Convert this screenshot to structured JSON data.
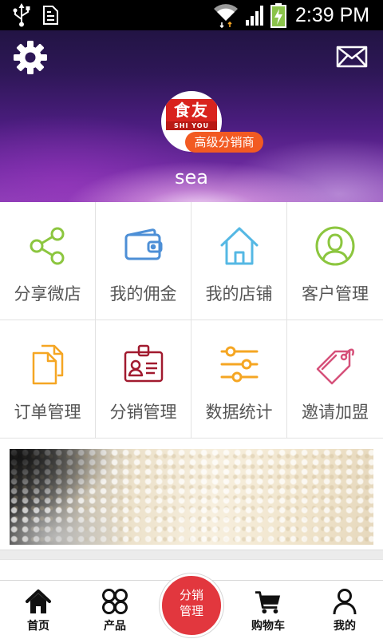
{
  "status_bar": {
    "time": "2:39 PM",
    "left_icons": [
      "usb-icon",
      "notification-app-icon"
    ],
    "right_icons": [
      "wifi-icon",
      "signal-icon",
      "battery-charging-icon"
    ],
    "battery_color": "#8bc34a"
  },
  "header": {
    "left_icon": "gear-icon",
    "right_icon": "envelope-icon"
  },
  "profile": {
    "username": "sea",
    "level_badge": "高级分销商",
    "badge_color": "#f25a22",
    "logo": {
      "main": "食友",
      "sub": "SHI YOU"
    }
  },
  "menu": [
    {
      "label": "分享微店",
      "icon": "share-icon",
      "color": "#8cc63f"
    },
    {
      "label": "我的佣金",
      "icon": "wallet-icon",
      "color": "#4d8fd6"
    },
    {
      "label": "我的店铺",
      "icon": "house-icon",
      "color": "#55b8e4"
    },
    {
      "label": "客户管理",
      "icon": "user-circle-icon",
      "color": "#8cc63f"
    },
    {
      "label": "订单管理",
      "icon": "documents-icon",
      "color": "#f5a623"
    },
    {
      "label": "分销管理",
      "icon": "id-badge-icon",
      "color": "#a11a2f"
    },
    {
      "label": "数据统计",
      "icon": "sliders-icon",
      "color": "#f5a623"
    },
    {
      "label": "邀请加盟",
      "icon": "tag-icon",
      "color": "#d6517a"
    }
  ],
  "bottom_nav": {
    "items": [
      {
        "label": "首页",
        "icon": "home-icon"
      },
      {
        "label": "产品",
        "icon": "grid-circles-icon"
      },
      {
        "label": "购物车",
        "icon": "cart-icon"
      },
      {
        "label": "我的",
        "icon": "person-icon"
      }
    ],
    "center_button": {
      "lines": [
        "分销",
        "管理"
      ],
      "color": "#e2373e"
    }
  }
}
